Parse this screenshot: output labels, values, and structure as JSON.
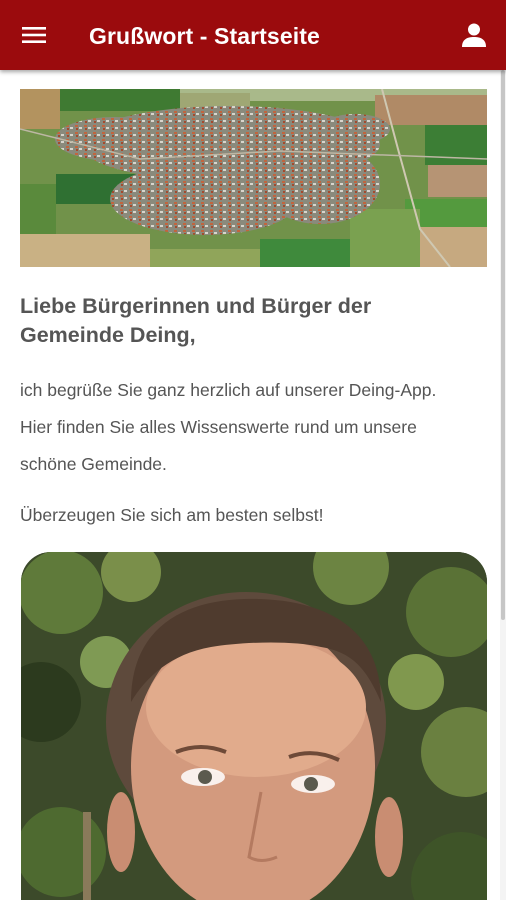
{
  "appbar": {
    "title": "Grußwort - Startseite",
    "color": "#9b0b0d",
    "menu_icon": "hamburger-menu-icon",
    "user_icon": "user-account-icon"
  },
  "content": {
    "greeting": "Liebe Bürgerinnen und Bürger der Gemeinde Deing,",
    "intro": "ich begrüße Sie ganz herzlich auf unserer Deing-App. Hier finden Sie alles Wissenswerte rund um unsere schöne Gemeinde.",
    "closing": "Überzeugen Sie sich am besten selbst!"
  },
  "text_color": "#555555"
}
